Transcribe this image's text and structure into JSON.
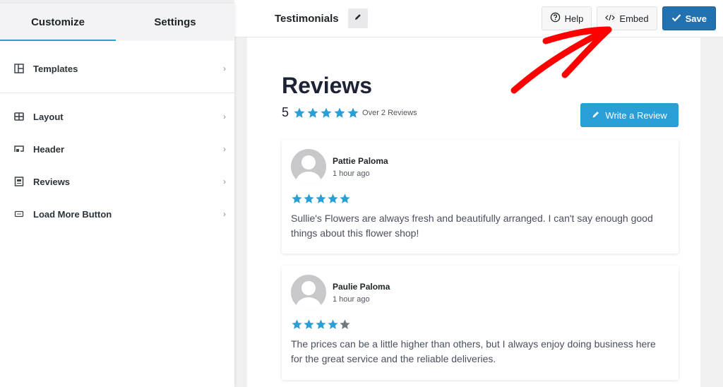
{
  "sidebar": {
    "tabs": [
      {
        "label": "Customize",
        "active": true
      },
      {
        "label": "Settings",
        "active": false
      }
    ],
    "items": [
      {
        "label": "Templates",
        "icon": "templates-icon"
      },
      {
        "label": "Layout",
        "icon": "layout-icon"
      },
      {
        "label": "Header",
        "icon": "header-icon"
      },
      {
        "label": "Reviews",
        "icon": "reviews-icon"
      },
      {
        "label": "Load More Button",
        "icon": "load-more-icon"
      }
    ]
  },
  "topbar": {
    "title": "Testimonials",
    "help_label": "Help",
    "embed_label": "Embed",
    "save_label": "Save"
  },
  "preview": {
    "heading": "Reviews",
    "average_score": "5",
    "average_stars": 5,
    "count_text": "Over 2 Reviews",
    "write_label": "Write a Review",
    "reviews": [
      {
        "name": "Pattie Paloma",
        "time": "1 hour ago",
        "rating": 5,
        "text": "Sullie's Flowers are always fresh and beautifully arranged. I can't say enough good things about this flower shop!"
      },
      {
        "name": "Paulie Paloma",
        "time": "1 hour ago",
        "rating": 4,
        "text": "The prices can be a little higher than others, but I always enjoy doing business here for the great service and the reliable deliveries."
      }
    ]
  },
  "colors": {
    "accent": "#2a9ed6",
    "save": "#2271b1",
    "star_filled": "#2a9ed6",
    "star_empty": "#72777c",
    "annotation_arrow": "#ff0000"
  }
}
